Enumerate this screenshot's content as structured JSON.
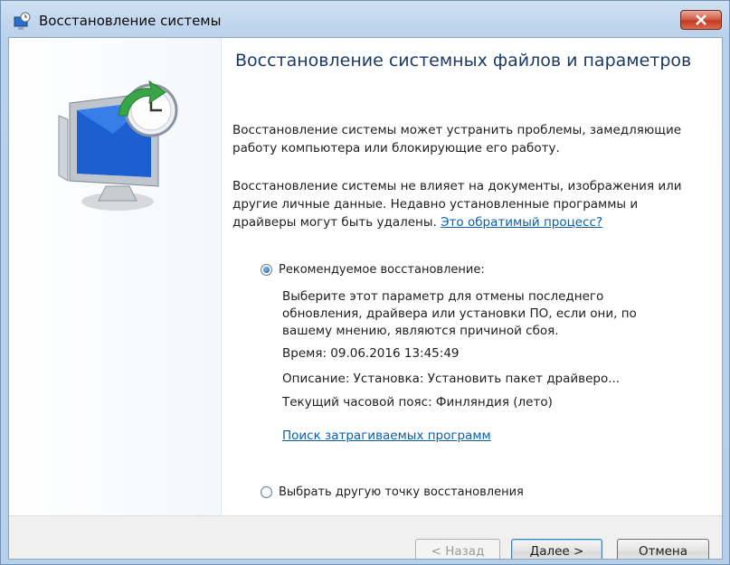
{
  "window": {
    "title": "Восстановление системы",
    "icon": "system-restore-icon"
  },
  "heading": "Восстановление системных файлов и параметров",
  "intro1": "Восстановление системы может устранить проблемы, замедляющие работу компьютера или блокирующие его работу.",
  "intro2": "Восстановление системы не влияет на документы, изображения или другие личные данные. Недавно установленные программы и драйверы могут быть удалены.",
  "reversible_link": "Это обратимый процесс?",
  "options": {
    "recommended": {
      "label": "Рекомендуемое восстановление:",
      "selected": true,
      "description": "Выберите этот параметр для отмены последнего обновления, драйвера или установки ПО, если они, по вашему мнению, являются причиной сбоя.",
      "time": "Время: 09.06.2016 13:45:49",
      "desc": "Описание: Установка: Установить пакет драйверо...",
      "timezone": "Текущий часовой пояс: Финляндия (лето)",
      "scan_link": "Поиск затрагиваемых программ"
    },
    "other": {
      "label": "Выбрать другую точку восстановления",
      "selected": false
    }
  },
  "buttons": {
    "back": "< Назад",
    "next": "Далее >",
    "cancel": "Отмена"
  },
  "colors": {
    "heading": "#1c3a66",
    "link": "#0b5fa8",
    "accent_green": "#3aa548"
  }
}
